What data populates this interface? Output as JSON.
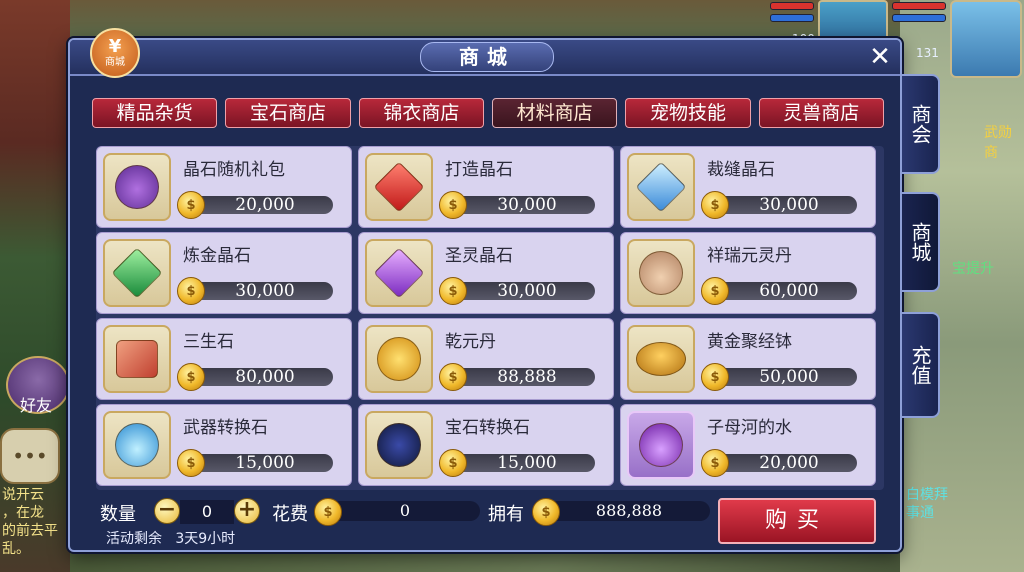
{
  "hud": {
    "level_left": "100",
    "level_right": "131"
  },
  "scene": {
    "friends_label": "好友",
    "side_text_1": "武勋商",
    "side_text_2": "宝提升",
    "chat_lines": [
      "说开云",
      "，在龙",
      "的前去平乱。"
    ],
    "right_bottom_1": "白模拜",
    "right_bottom_2": "事通"
  },
  "panel": {
    "title": "商城",
    "logo_symbol": "¥",
    "logo_label": "商城",
    "close_symbol": "✕"
  },
  "tabs": [
    {
      "label": "精品杂货",
      "active": false
    },
    {
      "label": "宝石商店",
      "active": false
    },
    {
      "label": "锦衣商店",
      "active": false
    },
    {
      "label": "材料商店",
      "active": true
    },
    {
      "label": "宠物技能",
      "active": false
    },
    {
      "label": "灵兽商店",
      "active": false
    }
  ],
  "items": [
    {
      "name": "晶石随机礼包",
      "price": "20,000",
      "icon": "gem-pouch-icon"
    },
    {
      "name": "打造晶石",
      "price": "30,000",
      "icon": "red-crystal-icon"
    },
    {
      "name": "裁缝晶石",
      "price": "30,000",
      "icon": "blue-crystal-icon"
    },
    {
      "name": "炼金晶石",
      "price": "30,000",
      "icon": "green-crystal-icon"
    },
    {
      "name": "圣灵晶石",
      "price": "30,000",
      "icon": "purple-crystal-icon"
    },
    {
      "name": "祥瑞元灵丹",
      "price": "60,000",
      "icon": "elixir-gourd-icon"
    },
    {
      "name": "三生石",
      "price": "80,000",
      "icon": "rebirth-stone-icon"
    },
    {
      "name": "乾元丹",
      "price": "88,888",
      "icon": "golden-pill-icon"
    },
    {
      "name": "黄金聚经钵",
      "price": "50,000",
      "icon": "golden-bowl-icon"
    },
    {
      "name": "武器转换石",
      "price": "15,000",
      "icon": "blue-flame-stone-icon"
    },
    {
      "name": "宝石转换石",
      "price": "15,000",
      "icon": "yin-yang-stone-icon"
    },
    {
      "name": "子母河的水",
      "price": "20,000",
      "icon": "purple-vase-icon"
    }
  ],
  "bottom": {
    "qty_label": "数量",
    "qty_value": "0",
    "minus_symbol": "−",
    "plus_symbol": "+",
    "cost_label": "花费",
    "cost_value": "0",
    "own_label": "拥有",
    "own_value": "888,888",
    "remain_label": "活动剩余",
    "remain_value": "3天9小时",
    "buy_label": "购买"
  },
  "side_tabs": [
    {
      "label": "商会",
      "active": false
    },
    {
      "label": "商城",
      "active": true
    },
    {
      "label": "充值",
      "active": false
    }
  ],
  "colors": {
    "panel_bg": "#1e2a52",
    "tab_red": "#b8283a",
    "card_bg": "#d9d3ef",
    "coin_gold": "#f0b82a"
  }
}
